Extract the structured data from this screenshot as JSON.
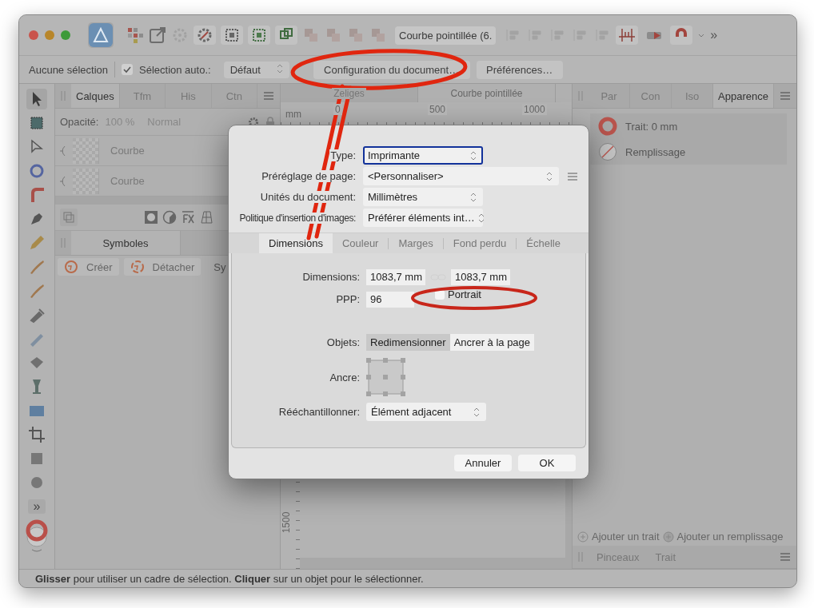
{
  "toolbar": {
    "document_label": "Courbe pointillée (6.",
    "overflow": "»"
  },
  "context_bar": {
    "selection": "Aucune sélection",
    "auto_select": {
      "label": "Sélection auto.:",
      "checked": true
    },
    "mode": "Défaut",
    "buttons": [
      "Configuration du document…",
      "Préférences…"
    ]
  },
  "left_panel": {
    "tabs": [
      {
        "label": "Calques",
        "selected": true
      },
      {
        "label": "Tfm",
        "selected": false
      },
      {
        "label": "His",
        "selected": false
      },
      {
        "label": "Ctn",
        "selected": false
      }
    ],
    "opacity_label": "Opacité:",
    "opacity": "100 %",
    "blend": "Normal",
    "layers": [
      {
        "name": "Courbe"
      },
      {
        "name": "Courbe"
      }
    ],
    "symbols": {
      "tab": "Symboles",
      "buttons": [
        "Créer",
        "Détacher"
      ],
      "sync": "Sy"
    }
  },
  "tools": {
    "more": "»"
  },
  "document_tabs": [
    {
      "label": "Zeliges",
      "selected": false
    },
    {
      "label": "Courbe pointillée",
      "selected": true
    }
  ],
  "ruler": {
    "unit": "mm",
    "ticks": [
      "0",
      "500",
      "1000"
    ],
    "vertical_tick": "1500"
  },
  "right_panel": {
    "tabs": [
      {
        "label": "Par",
        "selected": false
      },
      {
        "label": "Con",
        "selected": false
      },
      {
        "label": "Iso",
        "selected": false
      },
      {
        "label": "Apparence",
        "selected": true
      }
    ],
    "items": [
      {
        "label": "Trait: 0 mm",
        "kind": "stroke"
      },
      {
        "label": "Remplissage",
        "kind": "fill"
      }
    ],
    "add_buttons": [
      "Ajouter un trait",
      "Ajouter un remplissage"
    ],
    "bottom_tabs": [
      "Pinceaux",
      "Trait"
    ]
  },
  "dialog": {
    "fields": [
      {
        "label": "Type:",
        "value": "Imprimante",
        "kind": "select",
        "focused": true
      },
      {
        "label": "Préréglage de page:",
        "value": "<Personnaliser>",
        "kind": "preset",
        "focused": false
      },
      {
        "label": "Unités du document:",
        "value": "Millimètres",
        "kind": "select",
        "focused": false
      },
      {
        "label": "Politique d'insertion d'images:",
        "value": "Préférer éléments int…",
        "kind": "select",
        "focused": false
      }
    ],
    "tabs": [
      {
        "label": "Dimensions",
        "selected": true
      },
      {
        "label": "Couleur",
        "selected": false
      },
      {
        "label": "Marges",
        "selected": false
      },
      {
        "label": "Fond perdu",
        "selected": false
      },
      {
        "label": "Échelle",
        "selected": false
      }
    ],
    "dimensions": {
      "label": "Dimensions:",
      "width": "1083,7 mm",
      "height": "1083,7 mm"
    },
    "dpi": {
      "label": "PPP:",
      "value": "96"
    },
    "portrait": {
      "label": "Portrait",
      "checked": false
    },
    "objects": {
      "label": "Objets:",
      "options": [
        {
          "label": "Redimensionner",
          "selected": true
        },
        {
          "label": "Ancrer à la page",
          "selected": false
        }
      ]
    },
    "anchor_label": "Ancre:",
    "resample": {
      "label": "Rééchantillonner:",
      "value": "Élément adjacent"
    },
    "buttons": [
      "Annuler",
      "OK"
    ]
  },
  "status_bar": "**Glisser** pour utiliser un cadre de sélection. **Cliquer** sur un objet pour le sélectionner."
}
